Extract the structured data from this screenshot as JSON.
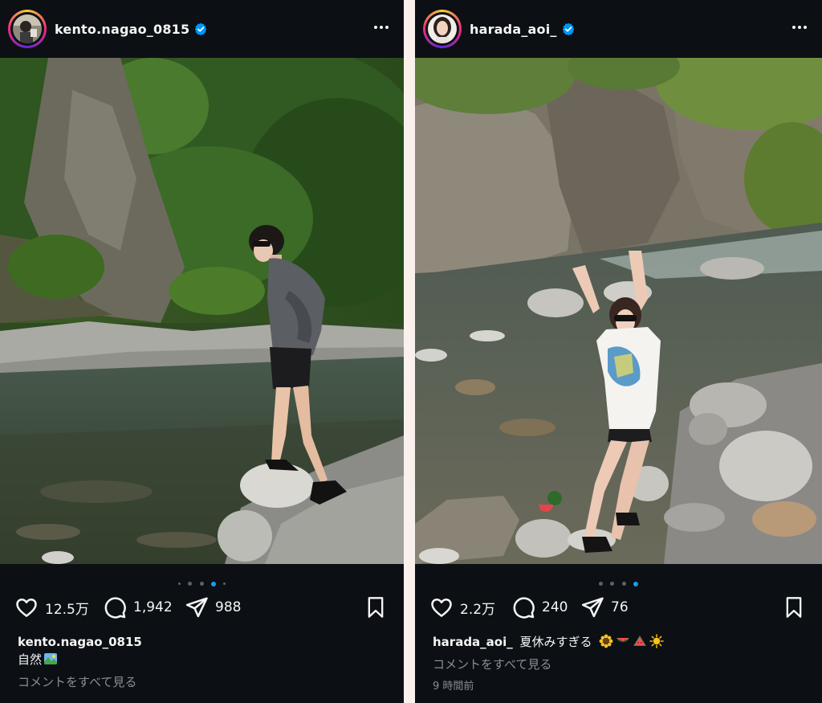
{
  "left_post": {
    "username": "kento.nagao_0815",
    "likes": "12.5万",
    "comments": "1,942",
    "shares": "988",
    "caption_user": "kento.nagao_0815",
    "caption_text": "自然",
    "caption_emoji": "landscape-photo-emoji",
    "view_comments": "コメントをすべて見る",
    "carousel": {
      "count": 5,
      "active_index": 3
    }
  },
  "right_post": {
    "username": "harada_aoi_",
    "likes": "2.2万",
    "comments": "240",
    "shares": "76",
    "caption_user": "harada_aoi_",
    "caption_text": "夏休みすぎる",
    "caption_emojis": [
      "sunflower-emoji",
      "watermelon-emoji",
      "watermelon-slice-emoji",
      "sun-emoji"
    ],
    "view_comments": "コメントをすべて見る",
    "timestamp": "9 時間前",
    "carousel": {
      "count": 4,
      "active_index": 3
    }
  },
  "colors": {
    "background": "#0c1014",
    "page": "#fbf1ec",
    "verified": "#0095f6",
    "carousel_active": "#1d9bf0",
    "secondary_text": "#8a8d91"
  }
}
